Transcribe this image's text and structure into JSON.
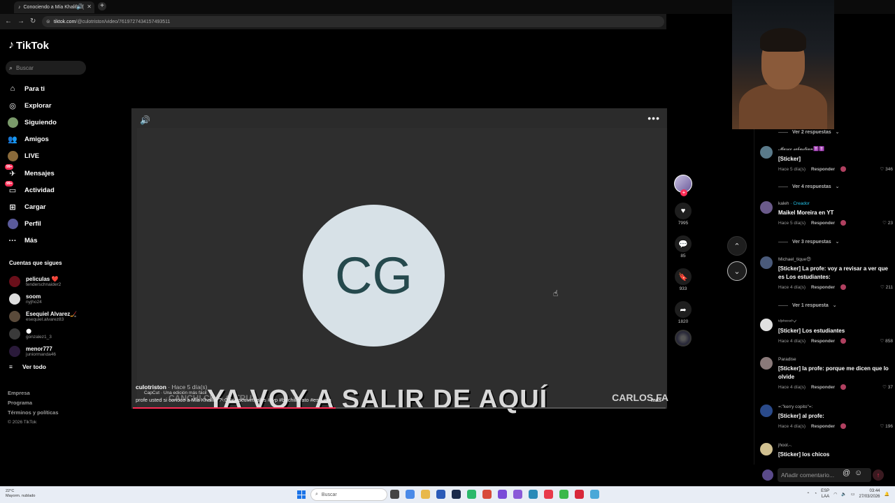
{
  "browser": {
    "tab_title": "Conociendo a Mía Khalifa :(",
    "url_domain": "tiktok.com",
    "url_path": "/@culotriston/video/7619727434157493511"
  },
  "sidebar": {
    "logo_text": "TikTok",
    "search_placeholder": "Buscar",
    "nav": [
      {
        "label": "Para ti",
        "icon": "home-icon"
      },
      {
        "label": "Explorar",
        "icon": "compass-icon"
      },
      {
        "label": "Siguiendo",
        "icon": "following-avatar-icon"
      },
      {
        "label": "Amigos",
        "icon": "friends-icon"
      },
      {
        "label": "LIVE",
        "icon": "live-icon"
      },
      {
        "label": "Mensajes",
        "icon": "messages-icon",
        "badge": "99+"
      },
      {
        "label": "Actividad",
        "icon": "activity-icon",
        "badge": "99+"
      },
      {
        "label": "Cargar",
        "icon": "upload-icon"
      },
      {
        "label": "Perfil",
        "icon": "profile-icon"
      },
      {
        "label": "Más",
        "icon": "more-icon"
      }
    ],
    "following_title": "Cuentas que sigues",
    "following": [
      {
        "name": "peliculas ❤️",
        "user": "tenderschnaider2",
        "color": "#6a0f1a"
      },
      {
        "name": "soom",
        "user": "nyjho24",
        "color": "#dddddd"
      },
      {
        "name": "Esequiel Alvarez🏒",
        "user": "esequiel.alvarez83",
        "color": "#5a4a3a"
      },
      {
        "name": "🌑",
        "user": "gonzalez1_3",
        "color": "#3a3a3a"
      },
      {
        "name": "menor777",
        "user": "juniormanda46",
        "color": "#2a1a3a"
      }
    ],
    "see_all": "Ver todo",
    "footer": [
      "Empresa",
      "Programa",
      "Términos y políticas"
    ],
    "copyright": "© 2026 TikTok"
  },
  "video": {
    "avatar_initials": "CG",
    "capcut_label": "CapCut · Una edición más fácil",
    "ghost_names": "CANCHI    CH    A G   TRU",
    "ghost_right": "CARLOS FA",
    "big_caption": "YA VOY A SALIR DE AQUÍ",
    "author": "culotriston",
    "time": " · Hace 5 día(s)",
    "description": "profe usted si conoce a Mia Khalifa ? :0 #clasesvirtuales #fyp #bachillerato #escuela",
    "more": "más",
    "progress": 0.38
  },
  "actions": {
    "likes": "7995",
    "comments": "85",
    "saves": "933",
    "shares": "1820"
  },
  "comments": [
    {
      "type": "replies",
      "text": "Ver 2 respuestas"
    },
    {
      "user": "𝓜𝓪𝓻𝓬𝓸 𝓼𝓮𝓫𝓪𝓼𝓽𝓲𝓪𝓷✝️✝️",
      "text": "[Sticker]",
      "meta": "Hace 5 día(s)",
      "likes": "346",
      "color": "#5a7a8a"
    },
    {
      "type": "replies",
      "text": "Ver 4 respuestas"
    },
    {
      "user": "kaleh",
      "creator": " · Creador",
      "text": "Maikel Moreira en YT",
      "meta": "Hace 5 día(s)",
      "likes": "23",
      "color": "#6a5a8a"
    },
    {
      "type": "replies",
      "text": "Ver 3 respuestas"
    },
    {
      "user": "Michael_tique😍",
      "text": "[Sticker] La profe: voy a revisar a ver que es Los estudiantes:",
      "meta": "Hace 4 día(s)",
      "likes": "211",
      "color": "#4a5a7a"
    },
    {
      "type": "replies",
      "text": "Ver 1 respuesta"
    },
    {
      "user": "ᵗᵈʲᵒᵏᵉᵒᵘᶜʰ✓",
      "text": "[Sticker] Los estudiantes",
      "meta": "Hace 4 día(s)",
      "likes": "858",
      "color": "#e0e0e0"
    },
    {
      "user": "Paradise",
      "text": "[Sticker] la profe: porque me dicen que lo olvide",
      "meta": "Hace 4 día(s)",
      "likes": "37",
      "color": "#8a7a7a"
    },
    {
      "user": "=:\"kerry copito\"=:",
      "text": "[Sticker] al profe:",
      "meta": "Hace 4 día(s)",
      "likes": "196",
      "color": "#2a4a8a"
    },
    {
      "user": "jhool.-.",
      "text": "[Sticker] los chicos",
      "meta": "",
      "likes": "",
      "color": "#d0c090"
    }
  ],
  "comment_input": {
    "placeholder": "Añadir comentario...",
    "reply_label": "Responder"
  },
  "taskbar": {
    "weather_temp": "22°C",
    "weather_desc": "Mayorm. nublado",
    "search": "Buscar",
    "lang": "ESP",
    "lang2": "LAA",
    "time": "03:44",
    "date": "27/03/2026"
  }
}
